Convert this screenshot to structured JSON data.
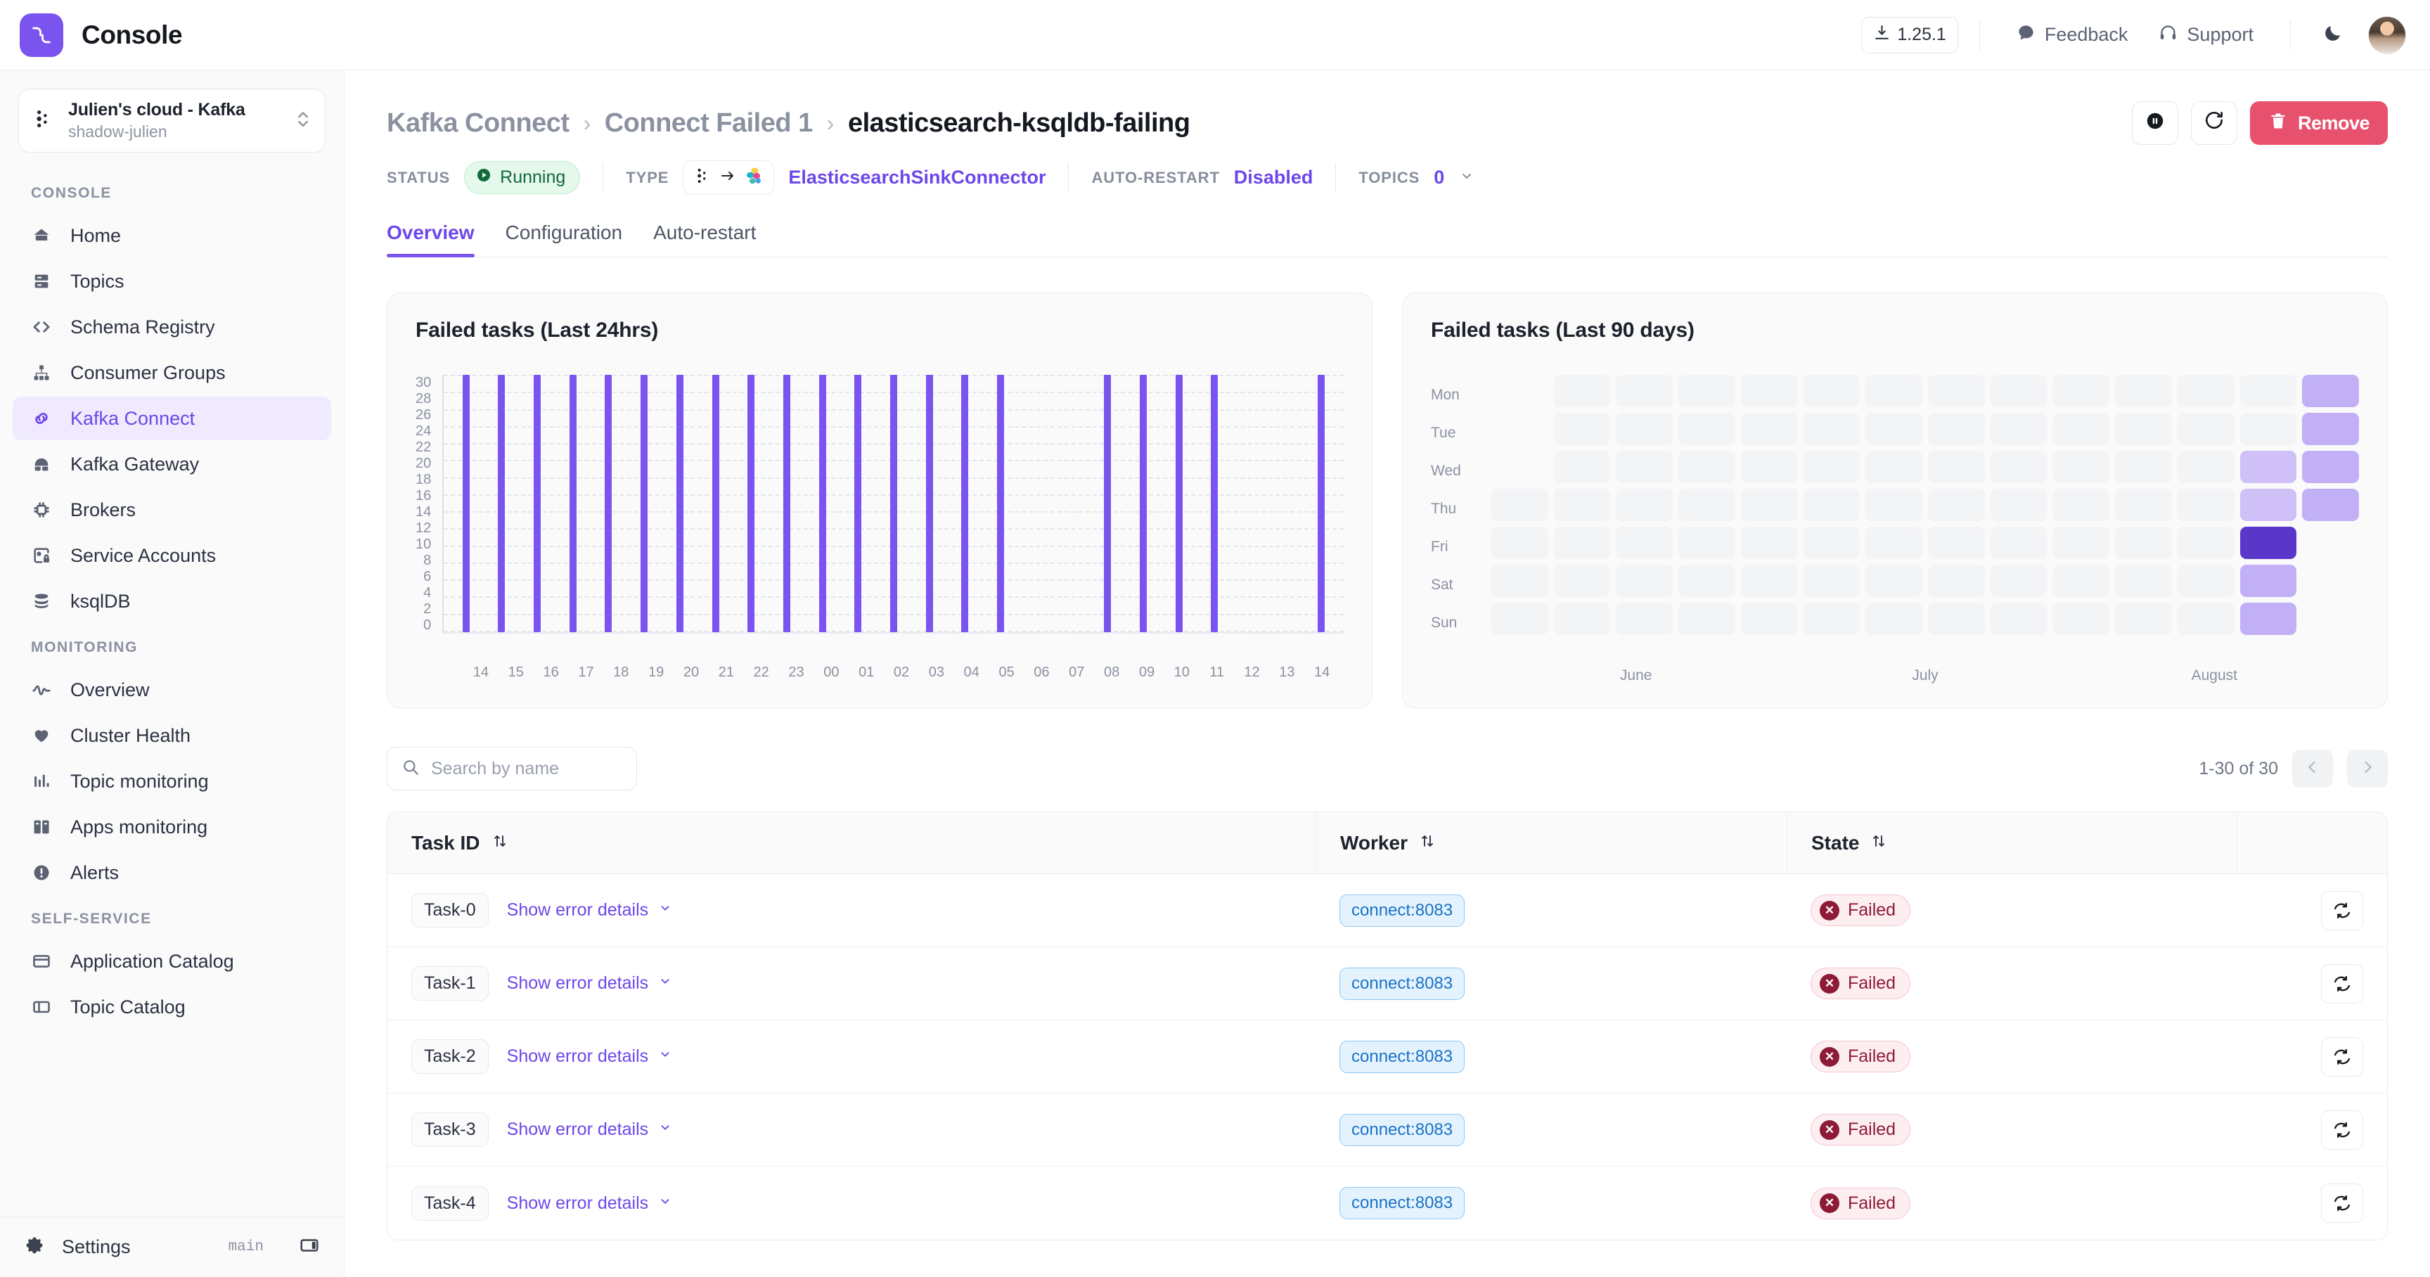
{
  "app": {
    "brand_name": "Console",
    "logo_icon": "conduktor-logo-icon"
  },
  "topbar": {
    "version": "1.25.1",
    "version_icon": "download-icon",
    "feedback": "Feedback",
    "feedback_icon": "chat-bubble-icon",
    "support": "Support",
    "support_icon": "headset-icon",
    "theme_icon": "moon-icon",
    "avatar": "user-avatar"
  },
  "sidebar": {
    "cluster": {
      "icon": "cluster-nodes-icon",
      "name": "Julien's cloud - Kafka",
      "sub": "shadow-julien",
      "chevron_icon": "chevron-up-down-icon"
    },
    "sections": [
      {
        "label": "CONSOLE",
        "items": [
          {
            "label": "Home",
            "icon": "home-icon",
            "active": false
          },
          {
            "label": "Topics",
            "icon": "topics-icon",
            "active": false
          },
          {
            "label": "Schema Registry",
            "icon": "code-brackets-icon",
            "active": false
          },
          {
            "label": "Consumer Groups",
            "icon": "hierarchy-icon",
            "active": false
          },
          {
            "label": "Kafka Connect",
            "icon": "link-icon",
            "active": true
          },
          {
            "label": "Kafka Gateway",
            "icon": "gateway-icon",
            "active": false
          },
          {
            "label": "Brokers",
            "icon": "gear-hub-icon",
            "active": false
          },
          {
            "label": "Service Accounts",
            "icon": "id-lock-icon",
            "active": false
          },
          {
            "label": "ksqlDB",
            "icon": "database-icon",
            "active": false
          }
        ]
      },
      {
        "label": "MONITORING",
        "items": [
          {
            "label": "Overview",
            "icon": "pulse-icon",
            "active": false
          },
          {
            "label": "Cluster Health",
            "icon": "heart-icon",
            "active": false
          },
          {
            "label": "Topic monitoring",
            "icon": "bar-chart-icon",
            "active": false
          },
          {
            "label": "Apps monitoring",
            "icon": "apps-icon",
            "active": false
          },
          {
            "label": "Alerts",
            "icon": "alert-icon",
            "active": false
          }
        ]
      },
      {
        "label": "SELF-SERVICE",
        "items": [
          {
            "label": "Application Catalog",
            "icon": "catalog-icon",
            "active": false
          },
          {
            "label": "Topic Catalog",
            "icon": "topic-catalog-icon",
            "active": false
          }
        ]
      }
    ],
    "footer": {
      "settings_label": "Settings",
      "settings_icon": "gear-icon",
      "branch": "main",
      "panel_icon": "panel-toggle-icon"
    }
  },
  "page": {
    "breadcrumb": [
      {
        "label": "Kafka Connect",
        "current": false
      },
      {
        "label": "Connect Failed 1",
        "current": false
      },
      {
        "label": "elasticsearch-ksqldb-failing",
        "current": true
      }
    ],
    "actions": {
      "pause_icon": "pause-circle-icon",
      "restart_icon": "restart-icon",
      "remove_label": "Remove",
      "remove_icon": "trash-icon",
      "remove_color": "#e8516e"
    },
    "status_bar": {
      "status_label": "STATUS",
      "status_value": "Running",
      "status_icon": "play-circle-icon",
      "status_color": "#12693c",
      "type_label": "TYPE",
      "type_value": "ElasticsearchSinkConnector",
      "type_source_icon": "kafka-nodes-icon",
      "type_arrow_icon": "arrow-right-icon",
      "type_target_icon": "elasticsearch-icon",
      "autorestart_label": "AUTO-RESTART",
      "autorestart_value": "Disabled",
      "topics_label": "TOPICS",
      "topics_value": "0",
      "topics_chevron_icon": "chevron-down-icon",
      "accent_color": "#6d47ea"
    },
    "tabs": [
      {
        "label": "Overview",
        "active": true
      },
      {
        "label": "Configuration",
        "active": false
      },
      {
        "label": "Auto-restart",
        "active": false
      }
    ]
  },
  "chart_data": [
    {
      "type": "bar",
      "title": "Failed tasks (Last 24hrs)",
      "xlabel": "",
      "ylabel": "",
      "ylim": [
        0,
        30
      ],
      "yticks": [
        30,
        28,
        26,
        24,
        22,
        20,
        18,
        16,
        14,
        12,
        10,
        8,
        6,
        4,
        2,
        0
      ],
      "grid": true,
      "bar_color": "#7b54f0",
      "categories": [
        "14",
        "15",
        "16",
        "17",
        "18",
        "19",
        "20",
        "21",
        "22",
        "23",
        "00",
        "01",
        "02",
        "03",
        "04",
        "05",
        "06",
        "07",
        "08",
        "09",
        "10",
        "11",
        "12",
        "13",
        "14"
      ],
      "values": [
        30,
        30,
        30,
        30,
        30,
        30,
        30,
        30,
        30,
        30,
        30,
        30,
        30,
        30,
        30,
        30,
        0,
        0,
        30,
        30,
        30,
        30,
        0,
        0,
        30
      ]
    },
    {
      "type": "heatmap",
      "title": "Failed tasks (Last 90 days)",
      "rows": [
        "Mon",
        "Tue",
        "Wed",
        "Thu",
        "Fri",
        "Sat",
        "Sun"
      ],
      "columns": 14,
      "month_labels": [
        "June",
        "July",
        "August"
      ],
      "empty_color": "#f3f4f6",
      "scale": [
        "#f3f4f6",
        "#ddd2fa",
        "#cfc0f8",
        "#c2b0f6",
        "#5a36c9"
      ],
      "cells": [
        [
          null,
          0,
          0,
          0,
          0,
          0,
          0,
          0,
          0,
          0,
          0,
          0,
          0,
          3
        ],
        [
          null,
          0,
          0,
          0,
          0,
          0,
          0,
          0,
          0,
          0,
          0,
          0,
          0,
          3
        ],
        [
          null,
          0,
          0,
          0,
          0,
          0,
          0,
          0,
          0,
          0,
          0,
          0,
          2,
          3
        ],
        [
          0,
          0,
          0,
          0,
          0,
          0,
          0,
          0,
          0,
          0,
          0,
          0,
          2,
          3
        ],
        [
          0,
          0,
          0,
          0,
          0,
          0,
          0,
          0,
          0,
          0,
          0,
          0,
          4,
          null
        ],
        [
          0,
          0,
          0,
          0,
          0,
          0,
          0,
          0,
          0,
          0,
          0,
          0,
          3,
          null
        ],
        [
          0,
          0,
          0,
          0,
          0,
          0,
          0,
          0,
          0,
          0,
          0,
          0,
          3,
          null
        ]
      ]
    }
  ],
  "table": {
    "search_placeholder": "Search by name",
    "search_value": "",
    "search_icon": "search-icon",
    "pager": {
      "count": "1-30 of 30",
      "prev_icon": "chevron-left-icon",
      "next_icon": "chevron-right-icon"
    },
    "columns": [
      {
        "label": "Task ID",
        "sort_icon": "sort-icon"
      },
      {
        "label": "Worker",
        "sort_icon": "sort-icon"
      },
      {
        "label": "State",
        "sort_icon": "sort-icon"
      },
      {
        "label": ""
      }
    ],
    "show_error_label": "Show error details",
    "show_error_chevron_icon": "chevron-down-icon",
    "row_restart_icon": "restart-task-icon",
    "state_icon": "error-circle-icon",
    "rows": [
      {
        "task_id": "Task-0",
        "worker": "connect:8083",
        "state": "Failed"
      },
      {
        "task_id": "Task-1",
        "worker": "connect:8083",
        "state": "Failed"
      },
      {
        "task_id": "Task-2",
        "worker": "connect:8083",
        "state": "Failed"
      },
      {
        "task_id": "Task-3",
        "worker": "connect:8083",
        "state": "Failed"
      },
      {
        "task_id": "Task-4",
        "worker": "connect:8083",
        "state": "Failed"
      }
    ]
  }
}
